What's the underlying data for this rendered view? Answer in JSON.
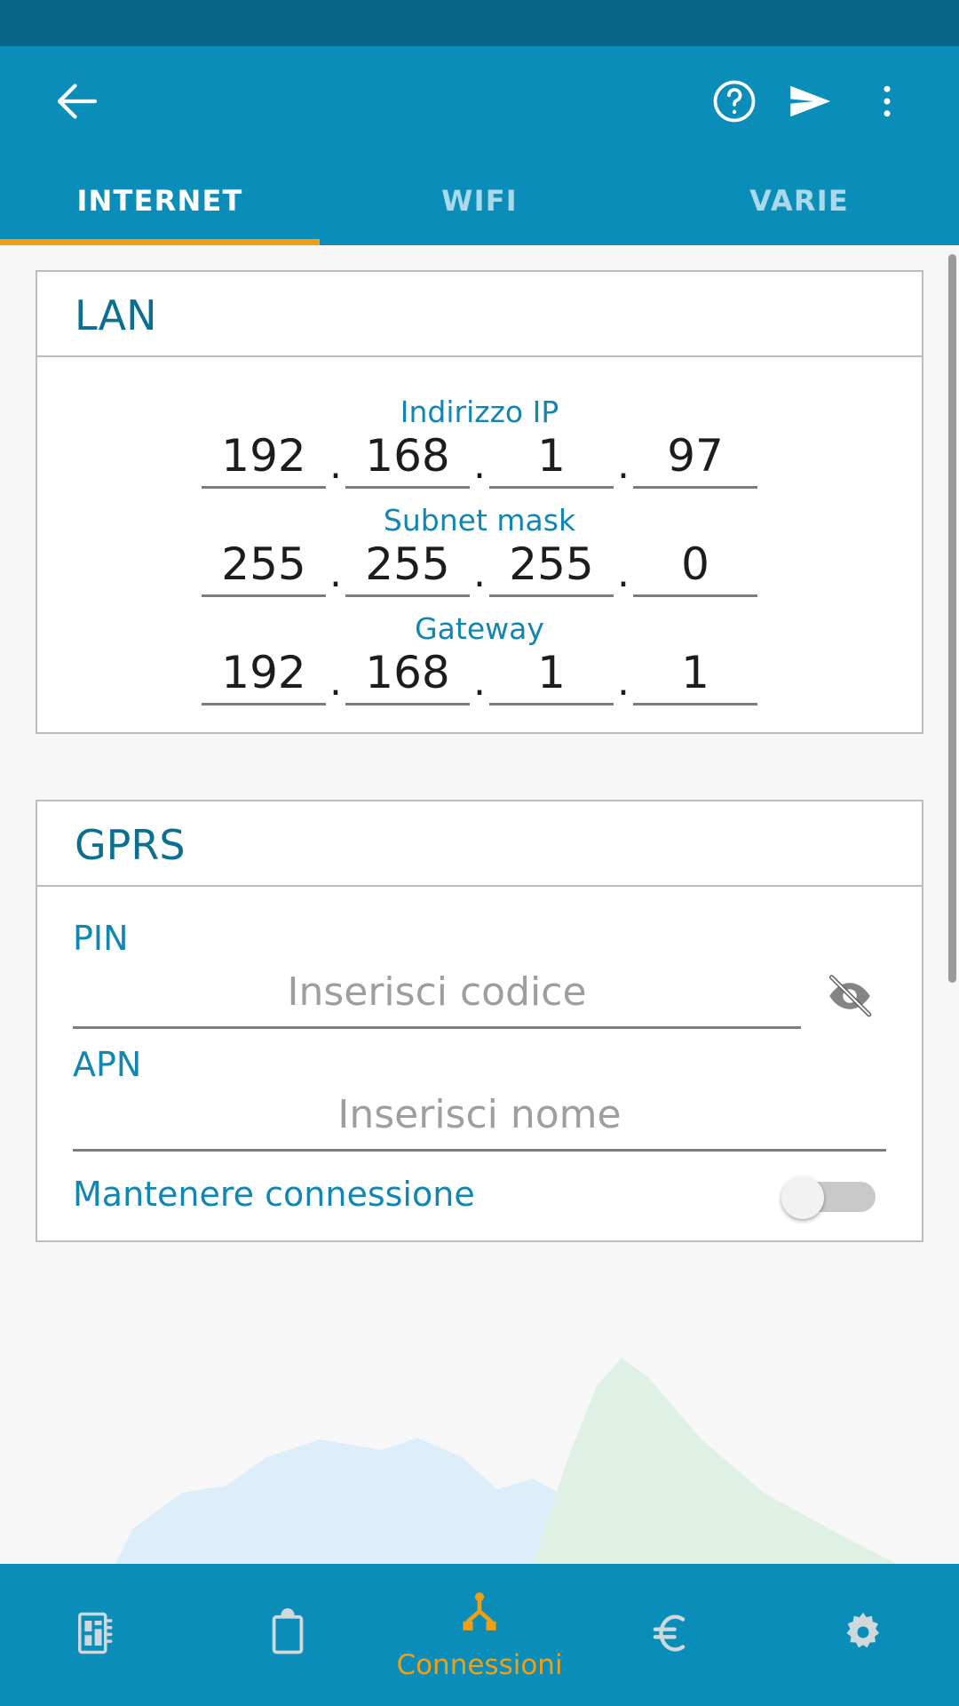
{
  "appbar": {
    "back_icon": "arrow-left-icon",
    "help_icon": "help-circle-icon",
    "send_icon": "send-icon",
    "overflow_icon": "more-vertical-icon"
  },
  "tabs": [
    {
      "label": "INTERNET",
      "active": true
    },
    {
      "label": "WIFI",
      "active": false
    },
    {
      "label": "VARIE",
      "active": false
    }
  ],
  "lan_card": {
    "title": "LAN",
    "fields": [
      {
        "label": "Indirizzo IP",
        "octets": [
          "192",
          "168",
          "1",
          "97"
        ]
      },
      {
        "label": "Subnet mask",
        "octets": [
          "255",
          "255",
          "255",
          "0"
        ]
      },
      {
        "label": "Gateway",
        "octets": [
          "192",
          "168",
          "1",
          "1"
        ]
      }
    ],
    "separator": "."
  },
  "gprs_card": {
    "title": "GPRS",
    "pin": {
      "label": "PIN",
      "value": "",
      "placeholder": "Inserisci codice",
      "reveal_icon": "eye-off-icon"
    },
    "apn": {
      "label": "APN",
      "value": "",
      "placeholder": "Inserisci nome"
    },
    "keep_connection": {
      "label": "Mantenere connessione",
      "checked": false
    }
  },
  "bottomnav": [
    {
      "icon": "device-module-icon",
      "label": "",
      "active": false
    },
    {
      "icon": "clipboard-icon",
      "label": "",
      "active": false
    },
    {
      "icon": "network-nodes-icon",
      "label": "Connessioni",
      "active": true
    },
    {
      "icon": "euro-icon",
      "label": "",
      "active": false
    },
    {
      "icon": "gear-icon",
      "label": "",
      "active": false
    }
  ],
  "colors": {
    "status_bar": "#0a6685",
    "app_bar": "#0b8dba",
    "accent": "#f0a012",
    "label_blue": "#1186b2",
    "title_blue": "#0c6f8f"
  }
}
